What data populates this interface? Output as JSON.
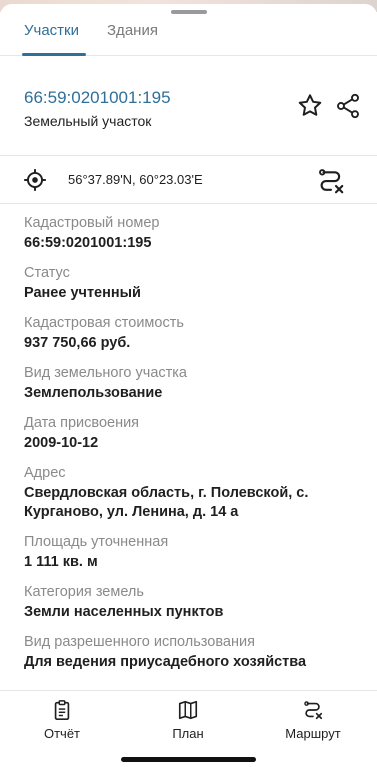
{
  "tabs": [
    {
      "label": "Участки"
    },
    {
      "label": "Здания"
    }
  ],
  "header": {
    "cadastral_link": "66:59:0201001:195",
    "object_type": "Земельный участок"
  },
  "coords": {
    "text": "56°37.89'N, 60°23.03'E"
  },
  "properties": [
    {
      "label": "Кадастровый номер",
      "value": "66:59:0201001:195"
    },
    {
      "label": "Статус",
      "value": "Ранее учтенный"
    },
    {
      "label": "Кадастровая стоимость",
      "value": "937 750,66 руб."
    },
    {
      "label": "Вид земельного участка",
      "value": "Землепользование"
    },
    {
      "label": "Дата присвоения",
      "value": "2009-10-12"
    },
    {
      "label": "Адрес",
      "value": "Свердловская область, г. Полевской, с. Курганово, ул. Ленина, д. 14 а"
    },
    {
      "label": "Площадь уточненная",
      "value": "1 111 кв. м"
    },
    {
      "label": "Категория земель",
      "value": "Земли населенных пунктов"
    },
    {
      "label": "Вид разрешенного использования",
      "value": "Для ведения приусадебного хозяйства"
    }
  ],
  "bottom_nav": [
    {
      "label": "Отчёт",
      "icon": "clipboard-icon"
    },
    {
      "label": "План",
      "icon": "map-icon"
    },
    {
      "label": "Маршрут",
      "icon": "route-icon"
    }
  ],
  "colors": {
    "accent": "#2f6f9a",
    "label_gray": "#8a8a8a"
  }
}
